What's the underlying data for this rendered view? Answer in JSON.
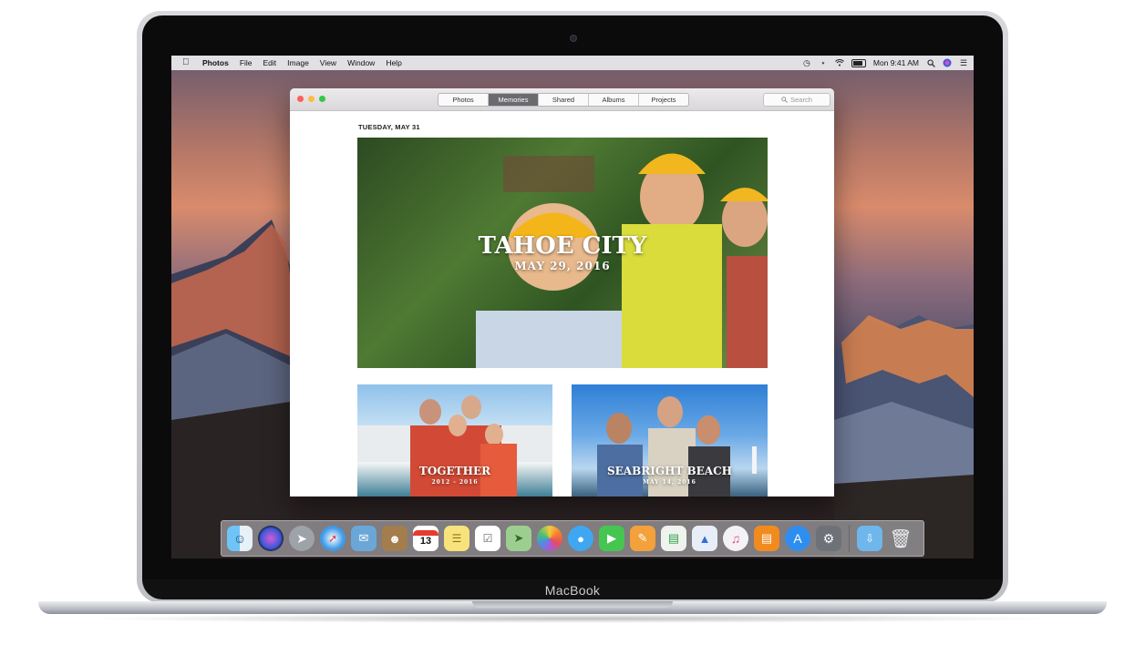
{
  "device": {
    "brand": "MacBook"
  },
  "menubar": {
    "apple_icon": "apple-icon",
    "app_name": "Photos",
    "menus": [
      "File",
      "Edit",
      "Image",
      "View",
      "Window",
      "Help"
    ],
    "status": {
      "time": "Mon 9:41 AM"
    }
  },
  "window": {
    "tabs": [
      {
        "label": "Photos",
        "active": false
      },
      {
        "label": "Memories",
        "active": true
      },
      {
        "label": "Shared",
        "active": false
      },
      {
        "label": "Albums",
        "active": false
      },
      {
        "label": "Projects",
        "active": false
      }
    ],
    "search_placeholder": "Search",
    "section_date": "TUESDAY, MAY 31",
    "memories": [
      {
        "title": "TAHOE CITY",
        "subtitle": "MAY 29, 2016"
      },
      {
        "title": "TOGETHER",
        "subtitle": "2012 - 2016"
      },
      {
        "title": "SEABRIGHT BEACH",
        "subtitle": "MAY 14, 2016"
      }
    ]
  },
  "dock": {
    "calendar_day": "13",
    "items": [
      "finder",
      "siri",
      "launchpad",
      "safari",
      "mail",
      "contacts",
      "calendar",
      "notes",
      "reminders",
      "maps",
      "photos",
      "messages",
      "facetime",
      "pages",
      "numbers",
      "keynote",
      "itunes",
      "ibooks",
      "app-store",
      "system-preferences",
      "downloads-folder",
      "trash"
    ]
  },
  "colors": {
    "active_tab": "#6b6a6e",
    "close": "#fc605b",
    "minimize": "#fdbc40",
    "zoom": "#34c84a"
  }
}
